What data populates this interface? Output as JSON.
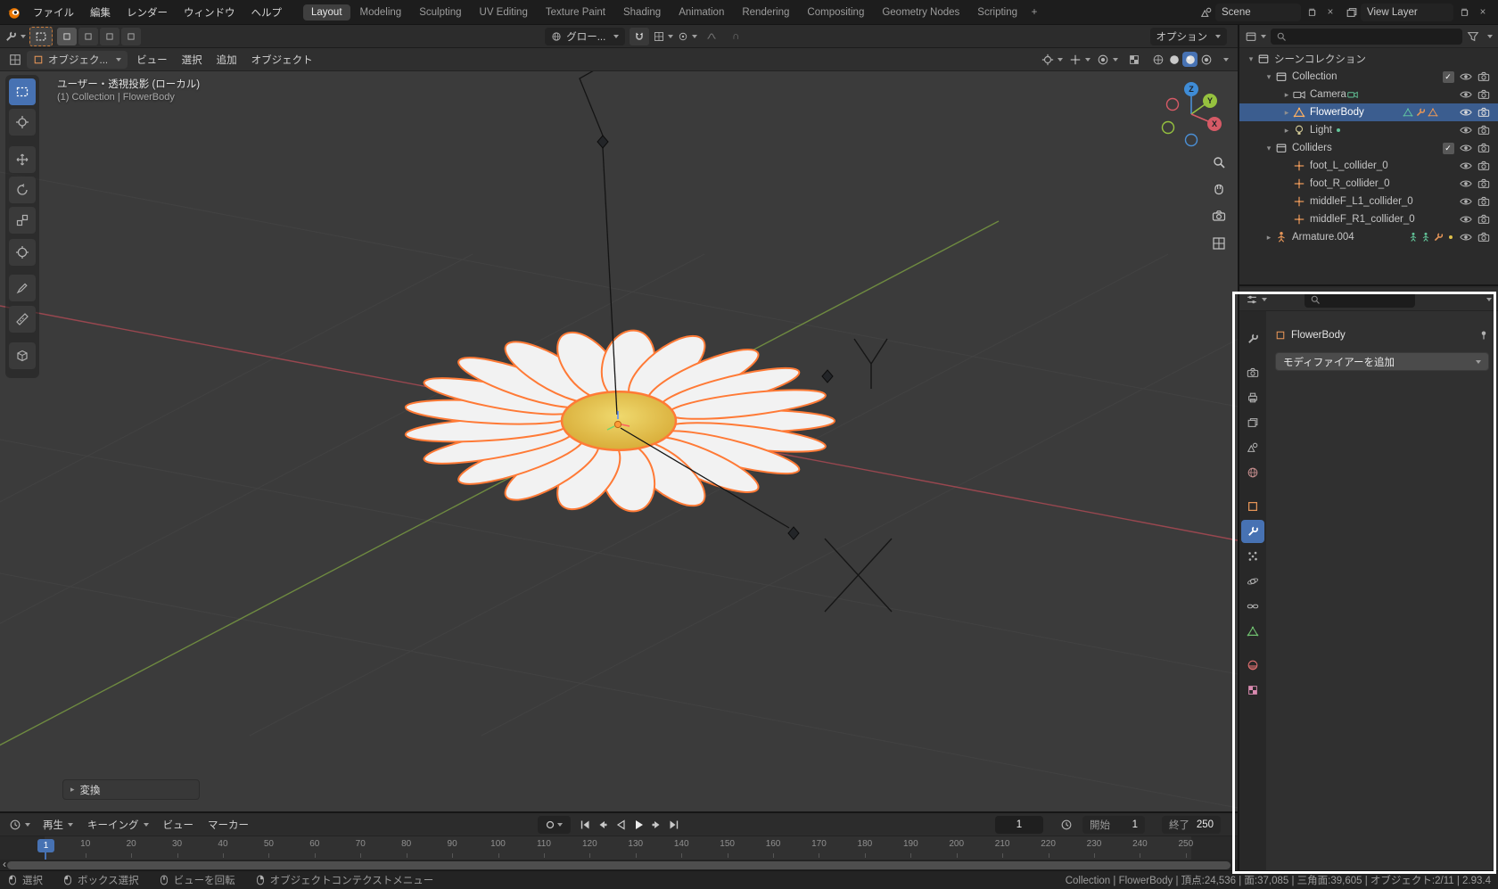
{
  "icons": {
    "chevron_right": "▸",
    "chevron_down": "▾",
    "check": "✓",
    "plus": "+",
    "close": "×",
    "angle_left": "‹",
    "cap": "∩"
  },
  "topbar": {
    "menus": [
      "ファイル",
      "編集",
      "レンダー",
      "ウィンドウ",
      "ヘルプ"
    ],
    "workspaces": [
      {
        "label": "Layout",
        "active": true
      },
      {
        "label": "Modeling"
      },
      {
        "label": "Sculpting"
      },
      {
        "label": "UV Editing"
      },
      {
        "label": "Texture Paint"
      },
      {
        "label": "Shading"
      },
      {
        "label": "Animation"
      },
      {
        "label": "Rendering"
      },
      {
        "label": "Compositing"
      },
      {
        "label": "Geometry Nodes"
      },
      {
        "label": "Scripting"
      }
    ],
    "scene_label": "Scene",
    "view_layer_label": "View Layer"
  },
  "tool_settings": {
    "orientation_label": "グロー...",
    "options_label": "オプション"
  },
  "viewport": {
    "mode_label": "オブジェク...",
    "menus": [
      "ビュー",
      "選択",
      "追加",
      "オブジェクト"
    ],
    "view_label": "ユーザー・透視投影 (ローカル)",
    "context_label": "(1) Collection | FlowerBody",
    "transform_panel_label": "変換",
    "axis": {
      "x": "X",
      "y": "Y",
      "z": "Z"
    }
  },
  "outliner": {
    "rows": [
      {
        "label": "シーンコレクション"
      },
      {
        "label": "Collection"
      },
      {
        "label": "Camera"
      },
      {
        "label": "FlowerBody"
      },
      {
        "label": "Light"
      },
      {
        "label": "Colliders"
      },
      {
        "label": "foot_L_collider_0"
      },
      {
        "label": "foot_R_collider_0"
      },
      {
        "label": "middleF_L1_collider_0"
      },
      {
        "label": "middleF_R1_collider_0"
      },
      {
        "label": "Armature.004"
      }
    ]
  },
  "properties": {
    "object_name": "FlowerBody",
    "add_modifier_label": "モディファイアーを追加"
  },
  "timeline": {
    "menus": [
      {
        "label": "再生",
        "dropdown": true
      },
      {
        "label": "キーイング",
        "dropdown": true
      },
      {
        "label": "ビュー"
      },
      {
        "label": "マーカー"
      }
    ],
    "current_frame": "1",
    "start_label": "開始",
    "start_value": "1",
    "end_label": "終了",
    "end_value": "250",
    "ticks": [
      "10",
      "20",
      "30",
      "40",
      "50",
      "60",
      "70",
      "80",
      "90",
      "100",
      "110",
      "120",
      "130",
      "140",
      "150",
      "160",
      "170",
      "180",
      "190",
      "200",
      "210",
      "220",
      "230",
      "240",
      "250"
    ]
  },
  "statusbar": {
    "hints": [
      {
        "label": "選択"
      },
      {
        "label": "ボックス選択"
      },
      {
        "label": "ビューを回転"
      },
      {
        "label": "オブジェクトコンテクストメニュー"
      }
    ],
    "info": "Collection | FlowerBody | 頂点:24,536 | 面:37,085 | 三角面:39,605 | オブジェクト:2/11 | 2.93.4"
  }
}
